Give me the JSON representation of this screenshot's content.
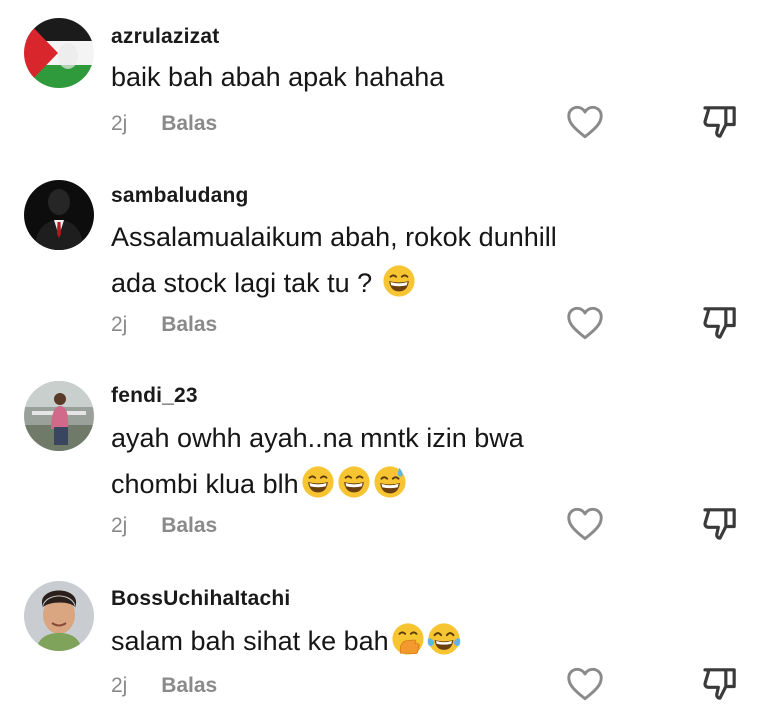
{
  "comments": [
    {
      "username": "azrulazizat",
      "lines": [
        "baik bah abah apak hahaha"
      ],
      "emojis": [],
      "time": "2j",
      "reply_label": "Balas"
    },
    {
      "username": "sambaludang",
      "lines": [
        "Assalamualaikum abah, rokok dunhill",
        "ada stock lagi tak tu ?"
      ],
      "emojis": [
        "grin"
      ],
      "time": "2j",
      "reply_label": "Balas"
    },
    {
      "username": "fendi_23",
      "lines": [
        "ayah owhh ayah..na mntk izin bwa",
        "chombi klua blh"
      ],
      "emojis": [
        "grin",
        "grin",
        "grin-sweat"
      ],
      "time": "2j",
      "reply_label": "Balas"
    },
    {
      "username": "BossUchihaItachi",
      "lines": [
        "salam bah sihat ke bah"
      ],
      "emojis": [
        "hand-over-mouth",
        "tears-of-joy"
      ],
      "time": "2j",
      "reply_label": "Balas"
    }
  ],
  "icons": {
    "like": "heart-outline-icon",
    "dislike": "thumbs-down-outline-icon"
  },
  "colors": {
    "text": "#161616",
    "meta": "#8a8a8a",
    "emoji_yellow": "#f7c531"
  }
}
